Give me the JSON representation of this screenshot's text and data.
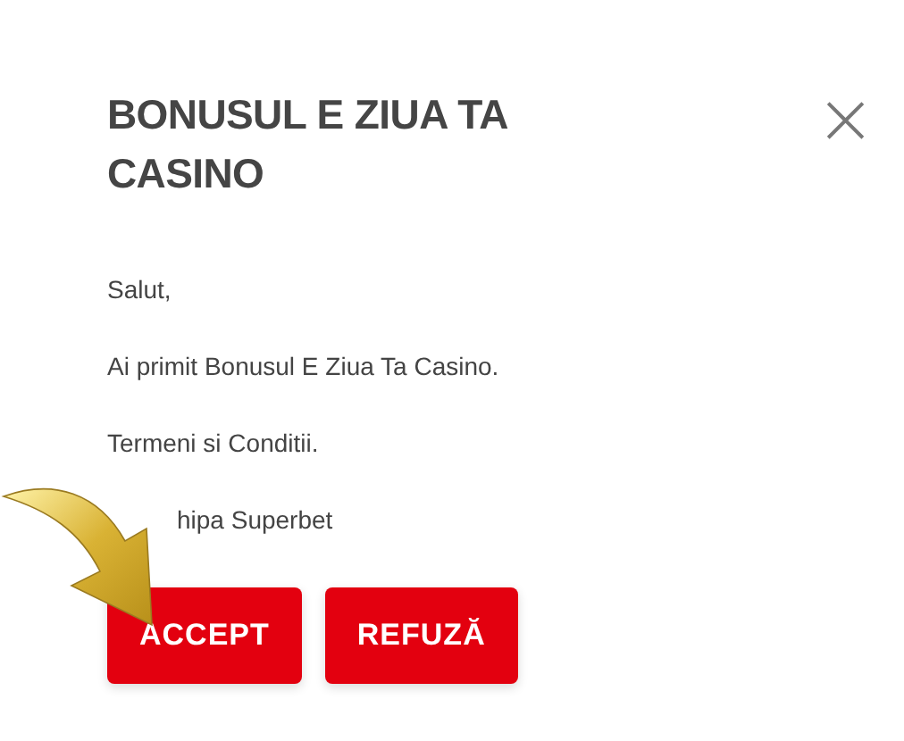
{
  "dialog": {
    "title": "BONUSUL E ZIUA TA CASINO",
    "close": "×",
    "paragraphs": [
      "Salut,",
      "Ai primit Bonusul E Ziua Ta Casino.",
      "Termeni si Conditii.",
      "hipa Superbet"
    ],
    "buttons": [
      {
        "label": "ACCEPT",
        "kind": "primary"
      },
      {
        "label": "REFUZĂ",
        "kind": "primary"
      }
    ]
  }
}
